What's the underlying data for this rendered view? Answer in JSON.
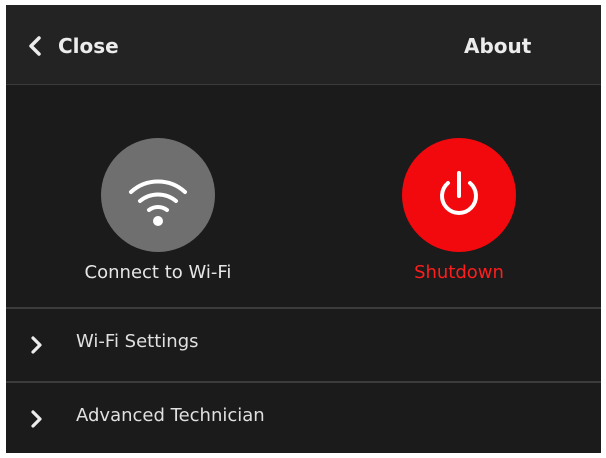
{
  "header": {
    "close_label": "Close",
    "close_icon": "chevron-left-icon",
    "about_label": "About"
  },
  "actions": [
    {
      "label": "Connect to Wi-Fi",
      "icon": "wifi-icon",
      "color": "#6f6f6f"
    },
    {
      "label": "Shutdown",
      "icon": "power-icon",
      "color": "#f2090d"
    }
  ],
  "menu": [
    {
      "label": "Wi-Fi Settings",
      "icon": "chevron-right-icon"
    },
    {
      "label": "Advanced Technician",
      "icon": "chevron-right-icon"
    }
  ]
}
